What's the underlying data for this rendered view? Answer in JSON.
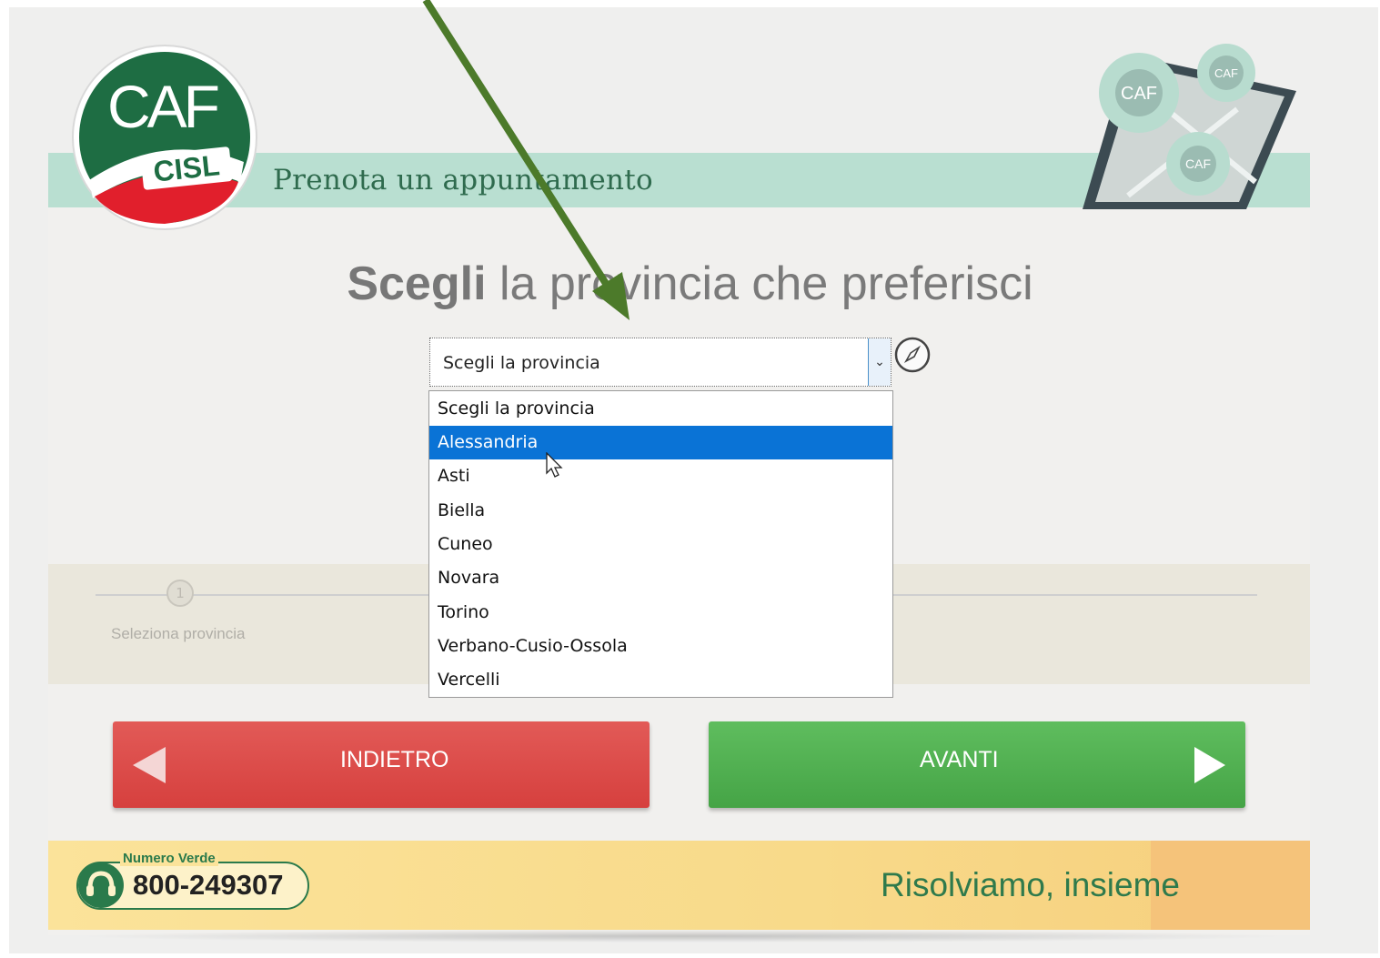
{
  "header": {
    "title": "Prenota un appuntamento",
    "logo_text_top": "CAF",
    "logo_text_bottom": "CISL"
  },
  "heading": {
    "bold": "Scegli",
    "rest": " la provincia che preferisci"
  },
  "province_select": {
    "current_value": "Scegli la provincia",
    "arrow": "⌄",
    "options": [
      "Scegli la provincia",
      "Alessandria",
      "Asti",
      "Biella",
      "Cuneo",
      "Novara",
      "Torino",
      "Verbano-Cusio-Ossola",
      "Vercelli"
    ],
    "highlighted_index": 1
  },
  "progress": {
    "step_number": "1",
    "step_label": "Seleziona provincia"
  },
  "buttons": {
    "back": "INDIETRO",
    "next": "AVANTI"
  },
  "footer": {
    "numero_verde_label": "Numero Verde",
    "phone": "800-249307",
    "slogan": "Risolviamo, insieme"
  },
  "colors": {
    "brand_green": "#1f6e44",
    "brand_red": "#d6403e",
    "selection_blue": "#0a73d6",
    "annotation_arrow": "#4c7a2a"
  }
}
